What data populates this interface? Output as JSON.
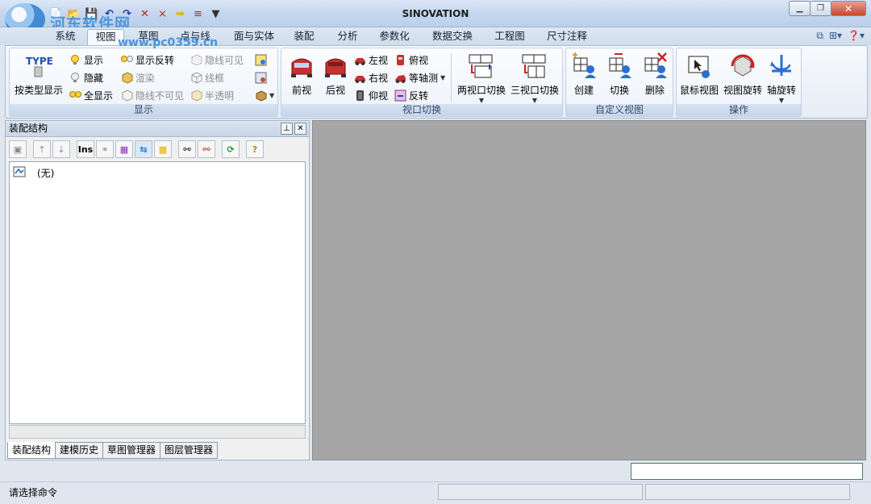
{
  "window": {
    "title": "SINOVATION",
    "watermark": "河东软件网",
    "watermark_url": "www.pc0359.cn",
    "controls": [
      "minimize",
      "maximize",
      "close"
    ]
  },
  "quick_access": [
    "new-icon",
    "open-icon",
    "save-icon",
    "undo-icon",
    "redo-icon",
    "delete-icon",
    "cut-icon",
    "arrow-icon",
    "menu-icon"
  ],
  "tabs": [
    {
      "label": "系统",
      "active": false
    },
    {
      "label": "视图",
      "active": true
    },
    {
      "label": "草图",
      "active": false
    },
    {
      "label": "点与线",
      "active": false
    },
    {
      "label": "面与实体",
      "active": false
    },
    {
      "label": "装配",
      "active": false
    },
    {
      "label": "分析",
      "active": false
    },
    {
      "label": "参数化",
      "active": false
    },
    {
      "label": "数据交换",
      "active": false
    },
    {
      "label": "工程图",
      "active": false
    },
    {
      "label": "尺寸注释",
      "active": false
    }
  ],
  "ribbon": {
    "display": {
      "label": "显示",
      "type_button": "按类型显示",
      "type_icon_text": "TYPE",
      "show": "显示",
      "hide": "隐藏",
      "show_all": "全显示",
      "show_invert": "显示反转",
      "render": "渲染",
      "hidden_invisible": "隐线不可见",
      "hidden_visible": "隐线可见",
      "wireframe": "线框",
      "translucent": "半透明"
    },
    "view_switch": {
      "label": "视口切换",
      "front": "前视",
      "back": "后视",
      "left": "左视",
      "right": "右视",
      "bottom": "仰视",
      "top": "俯视",
      "isometric": "等轴测",
      "reverse": "反转",
      "two_viewport": "两视口切换",
      "three_viewport": "三视口切换"
    },
    "custom_view": {
      "label": "自定义视图",
      "create": "创建",
      "switch": "切换",
      "delete": "删除"
    },
    "operation": {
      "label": "操作",
      "mouse_view": "鼠标视图",
      "view_rotate": "视图旋转",
      "axis_rotate": "轴旋转"
    }
  },
  "panel": {
    "title": "装配结构",
    "tree_item": "(无)",
    "toolbar_ins": "Ins",
    "tabs": [
      "装配结构",
      "建模历史",
      "草图管理器",
      "图层管理器"
    ]
  },
  "status": {
    "message": "请选择命令"
  },
  "colors": {
    "ribbon_bg": "#eef3f9",
    "viewport_bg": "#a6a6a6",
    "accent": "#2d7fd0"
  }
}
